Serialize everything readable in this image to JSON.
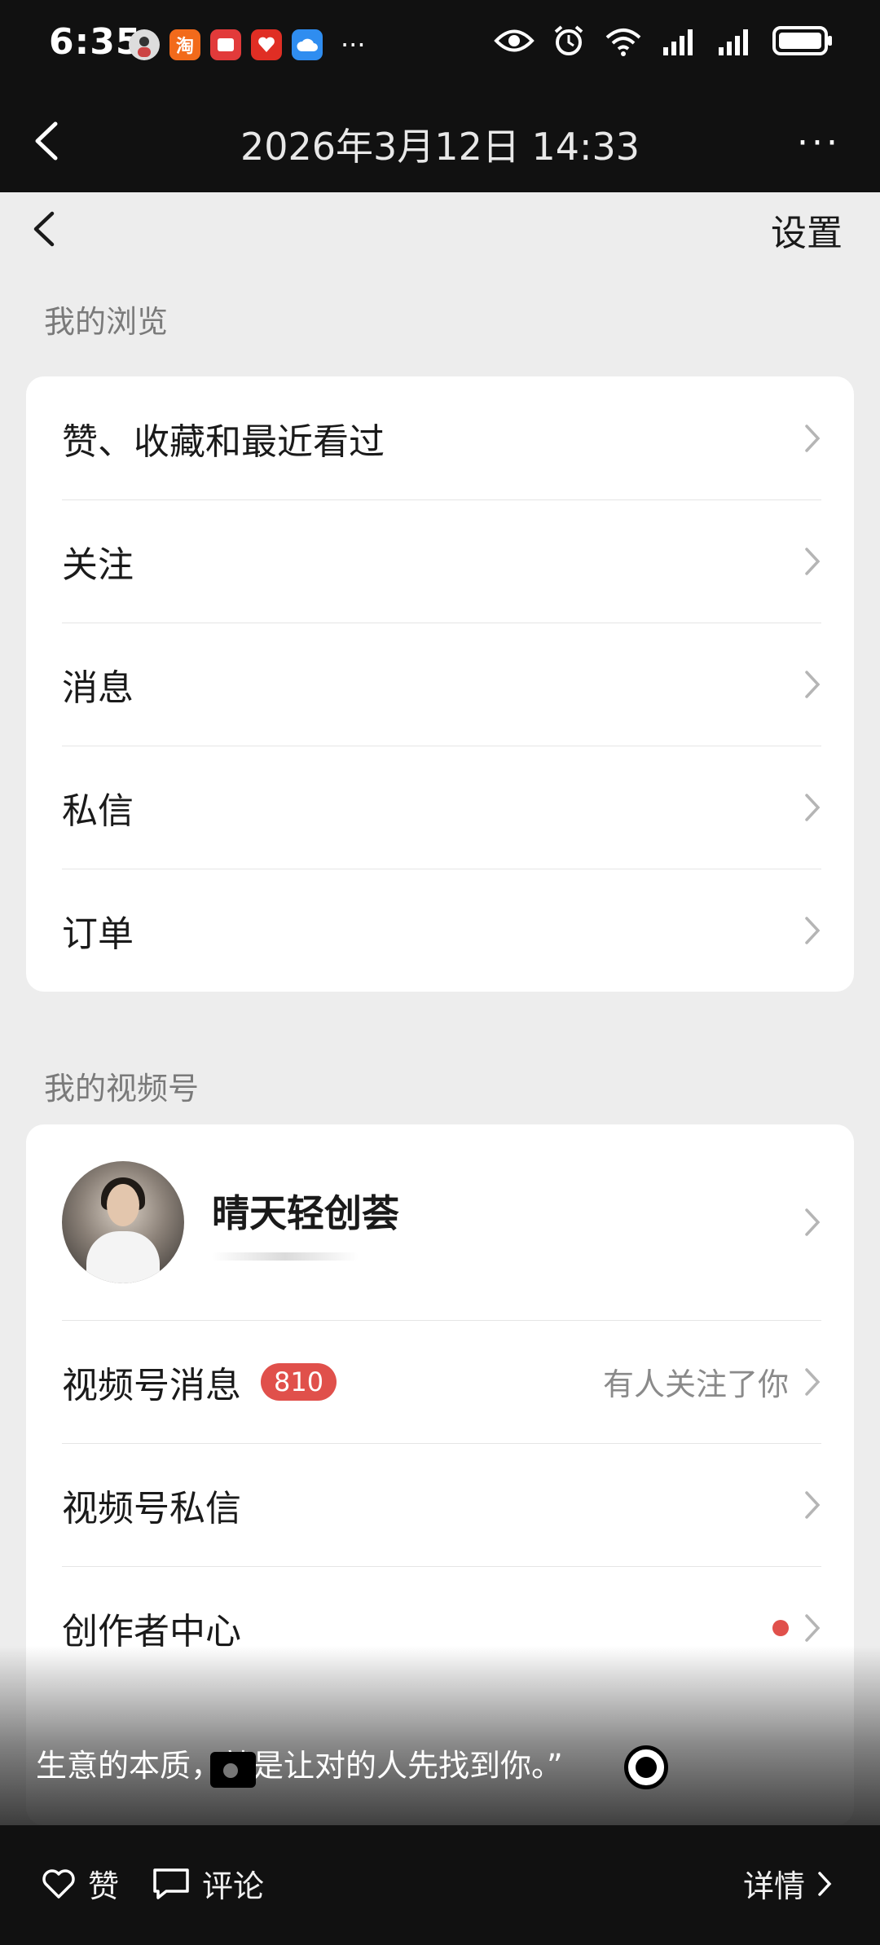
{
  "status_bar": {
    "time": "6:35",
    "app_icons": [
      "avatar-app",
      "taobao",
      "reader-app",
      "pinduoduo-app",
      "cloud-app"
    ],
    "taobao_label": "淘",
    "more": "···"
  },
  "viewer": {
    "title": "2026年3月12日 14:33",
    "more": "···"
  },
  "page": {
    "settings_label": "设置",
    "browse_section": "我的浏览",
    "browse_items": [
      "赞、收藏和最近看过",
      "关注",
      "消息",
      "私信",
      "订单"
    ],
    "channels_section": "我的视频号",
    "profile_name": "晴天轻创荟",
    "channel_items": {
      "messages": "视频号消息",
      "messages_badge": "810",
      "messages_hint": "有人关注了你",
      "private": "视频号私信",
      "creator": "创作者中心"
    }
  },
  "overlay": {
    "caption": "生意的本质，就是让对的人先找到你。”"
  },
  "bottom_bar": {
    "like": "赞",
    "comment": "评论",
    "details": "详情"
  },
  "colors": {
    "accent_red": "#e0504b",
    "dark_bar": "#111111",
    "page_bg": "#ededed"
  }
}
